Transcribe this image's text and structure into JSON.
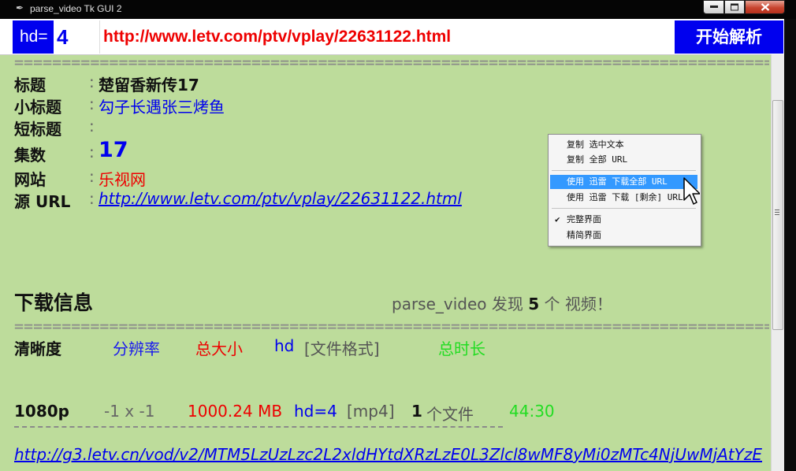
{
  "window": {
    "title": "parse_video Tk GUI 2"
  },
  "inputbar": {
    "hd_label": "hd=",
    "hd_value": "4",
    "url_value": "http://www.letv.com/ptv/vplay/22631122.html",
    "parse_button": "开始解析"
  },
  "separator": "========================================================================================================================",
  "info": {
    "title_label": "标题",
    "title_value": "楚留香新传17",
    "subtitle_label": "小标题",
    "subtitle_value": "勾子长遇张三烤鱼",
    "short_title_label": "短标题",
    "short_title_value": "",
    "episode_label": "集数",
    "episode_value": "17",
    "site_label": "网站",
    "site_value": "乐视网",
    "source_label": "源 URL",
    "source_value": "http://www.letv.com/ptv/vplay/22631122.html",
    "colon": ":"
  },
  "download": {
    "heading": "下载信息",
    "found_prefix": "parse_video 发现",
    "found_count": "5",
    "found_suffix": "个 视频！",
    "columns": {
      "quality": "清晰度",
      "resolution": "分辨率",
      "size": "总大小",
      "hd": "hd",
      "format": "[文件格式]",
      "duration": "总时长"
    },
    "video": {
      "quality": "1080p",
      "resolution": "-1 x -1",
      "size": "1000.24 MB",
      "hd": "hd=4",
      "format": "[mp4]",
      "files_count": "1",
      "files_label": "个文件",
      "duration": "44:30"
    },
    "link": "http://g3.letv.cn/vod/v2/MTM5LzUzLzc2L2xldHYtdXRzLzE0L3Zlcl8wMF8yMi0zMTc4NjUwMjAtYzE"
  },
  "context_menu": {
    "items": [
      "复制 选中文本",
      "复制 全部 URL",
      "使用 迅雷 下载全部 URL",
      "使用 迅雷 下载 [剩余] URL",
      "完整界面",
      "精简界面"
    ],
    "highlighted_index": 2,
    "checked_index": 4
  },
  "colors": {
    "background": "#bddc9b",
    "accent_blue": "#0000ee",
    "accent_red": "#ee0000",
    "green": "#22dd22"
  }
}
